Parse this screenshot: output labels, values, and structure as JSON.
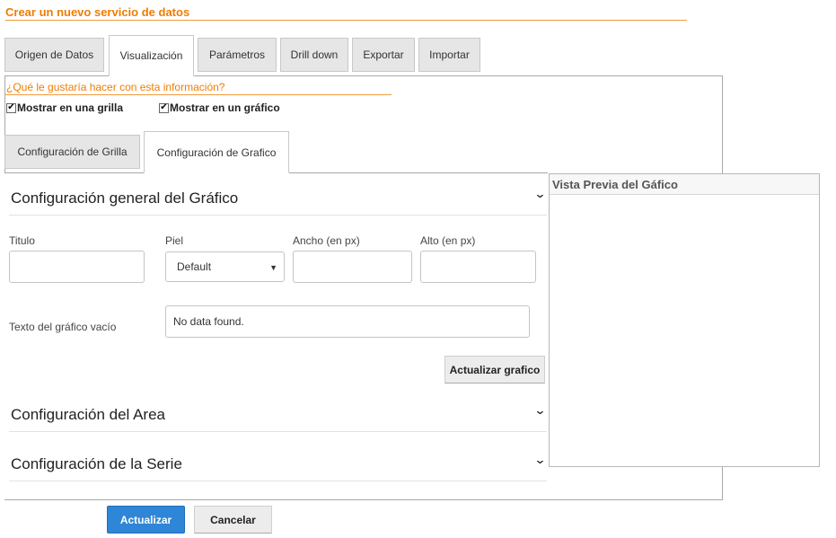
{
  "page": {
    "title": "Crear un nuevo servicio de datos"
  },
  "tabs": [
    {
      "label": "Origen de Datos"
    },
    {
      "label": "Visualización"
    },
    {
      "label": "Parámetros"
    },
    {
      "label": "Drill down"
    },
    {
      "label": "Exportar"
    },
    {
      "label": "Importar"
    }
  ],
  "visualization": {
    "question": "¿Qué le gustaría hacer con esta información?",
    "options": [
      {
        "label": "Mostrar en una grilla",
        "checked": true
      },
      {
        "label": "Mostrar en un gráfico",
        "checked": true
      }
    ],
    "check_glyph": "✔",
    "subtabs": [
      {
        "label": "Configuración de Grilla"
      },
      {
        "label": "Configuración de Grafico"
      }
    ]
  },
  "general": {
    "title": "Configuración general del Gráfico",
    "chevron": "⌄",
    "fields": {
      "titulo_label": "Titulo",
      "titulo_value": "",
      "piel_label": "Piel",
      "piel_value": "Default",
      "ancho_label": "Ancho (en px)",
      "ancho_value": "",
      "alto_label": "Alto (en px)",
      "alto_value": "",
      "empty_text_label": "Texto del gráfico vacío",
      "empty_text_value": "No data found."
    },
    "update_chart_button": "Actualizar grafico"
  },
  "sections": [
    {
      "title": "Configuración del Area"
    },
    {
      "title": "Configuración de la Serie"
    }
  ],
  "preview": {
    "title": "Vista Previa del Gáfico"
  },
  "footer": {
    "update_button": "Actualizar",
    "cancel_button": "Cancelar"
  }
}
